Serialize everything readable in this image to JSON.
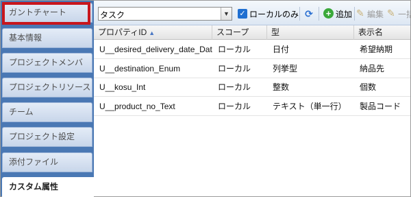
{
  "sidebar": {
    "items": [
      {
        "label": "ガントチャート"
      },
      {
        "label": "基本情報"
      },
      {
        "label": "プロジェクトメンバ"
      },
      {
        "label": "プロジェクトリソース"
      },
      {
        "label": "チーム"
      },
      {
        "label": "プロジェクト設定"
      },
      {
        "label": "添付ファイル"
      },
      {
        "label": "カスタム属性"
      }
    ],
    "active": "カスタム属性"
  },
  "toolbar": {
    "object_select": "タスク",
    "local_only_label": "ローカルのみ",
    "local_only_checked": true,
    "add_label": "追加",
    "edit_label": "編集",
    "delete_label": "一括"
  },
  "table": {
    "columns": [
      "プロパティID",
      "スコープ",
      "型",
      "表示名"
    ],
    "sort_column": "プロパティID",
    "rows": [
      [
        "U__desired_delivery_date_Date",
        "ローカル",
        "日付",
        "希望納期"
      ],
      [
        "U__destination_Enum",
        "ローカル",
        "列挙型",
        "納品先"
      ],
      [
        "U__kosu_Int",
        "ローカル",
        "整数",
        "個数"
      ],
      [
        "U__product_no_Text",
        "ローカル",
        "テキスト（単一行）",
        "製品コード"
      ]
    ]
  },
  "colors": {
    "sidebar_bg": "#4a78b4",
    "highlight": "#c8161d",
    "checkbox": "#1f6fd1"
  }
}
